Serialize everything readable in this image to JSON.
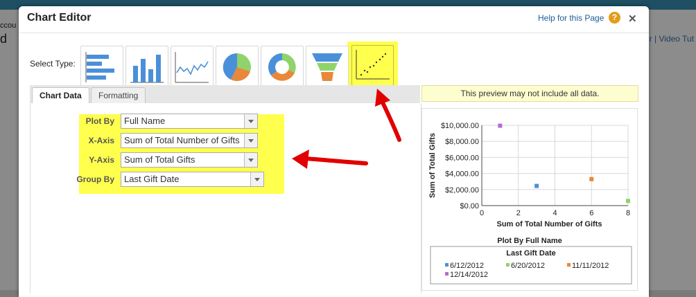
{
  "background": {
    "left_fragments": [
      "ccou",
      "d"
    ],
    "right_links": "ur | Video Tut"
  },
  "dialog": {
    "title": "Chart Editor",
    "help_link": "Help for this Page",
    "help_icon": "question-icon",
    "close_icon": "close-icon"
  },
  "select_type": {
    "label": "Select Type:",
    "types": [
      "horizontal-bar-icon",
      "vertical-bar-icon",
      "line-icon",
      "pie-icon",
      "donut-icon",
      "funnel-icon",
      "scatter-icon"
    ],
    "selected": "scatter-icon",
    "highlight_color": "#ffff4d"
  },
  "tabs": [
    "Chart Data",
    "Formatting"
  ],
  "fields": [
    {
      "label": "Plot By",
      "value": "Full Name"
    },
    {
      "label": "X-Axis",
      "value": "Sum of Total Number of Gifts"
    },
    {
      "label": "Y-Axis",
      "value": "Sum of Total Gifts"
    },
    {
      "label": "Group By",
      "value": "Last Gift Date"
    }
  ],
  "preview_note": "This preview may not include all data.",
  "annotation_arrow_color": "#e00000",
  "chart_data": {
    "type": "scatter",
    "xlabel": "Sum of Total Number of Gifts",
    "ylabel": "Sum of Total Gifts",
    "xlim": [
      0,
      8
    ],
    "ylim": [
      0,
      10000
    ],
    "xticks": [
      "0",
      "2",
      "4",
      "6",
      "8"
    ],
    "yticks": [
      "$0.00",
      "$2,000.00",
      "$4,000.00",
      "$6,000.00",
      "$8,000.00",
      "$10,000.00"
    ],
    "grid": true,
    "legend_title": "Plot By Full Name",
    "legend_subtitle": "Last Gift Date",
    "series": [
      {
        "name": "6/12/2012",
        "color": "#4a90d9",
        "points": [
          [
            3,
            2450
          ]
        ]
      },
      {
        "name": "6/20/2012",
        "color": "#8fd36b",
        "points": [
          [
            8,
            580
          ]
        ]
      },
      {
        "name": "11/11/2012",
        "color": "#e8883a",
        "points": [
          [
            6,
            3300
          ]
        ]
      },
      {
        "name": "12/14/2012",
        "color": "#b56ad1",
        "points": [
          [
            1,
            9950
          ]
        ]
      }
    ]
  }
}
